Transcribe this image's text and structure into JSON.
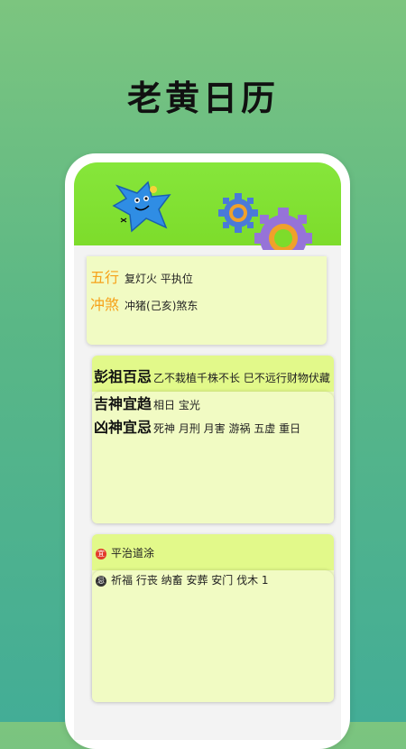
{
  "app": {
    "title": "老黄日历"
  },
  "info": {
    "wuxing_label": "五行",
    "wuxing_value": "复灯火 平执位",
    "chongsha_label": "冲煞",
    "chongsha_value": "冲猪(己亥)煞东"
  },
  "auspicious": {
    "pengzu_label": "彭祖百忌",
    "pengzu_value": "乙不栽植千株不长 巳不远行财物伏藏",
    "jishen_label": "吉神宜趋",
    "jishen_value": "相日 宝光",
    "xiongshen_label": "凶神宜忌",
    "xiongshen_value": "死神 月刑 月害 游祸 五虚 重日"
  },
  "yiji": {
    "yi_badge": "宜",
    "yi_value": "平治道涂",
    "ji_badge": "忌",
    "ji_value": "祈福 行丧 纳畜 安葬 安门 伐木 1"
  },
  "colors": {
    "orange_label": "#f6a21a",
    "banner_green": "#7ddc2b",
    "card_bg": "#f1fbc3",
    "card_head": "#e2f98a"
  }
}
